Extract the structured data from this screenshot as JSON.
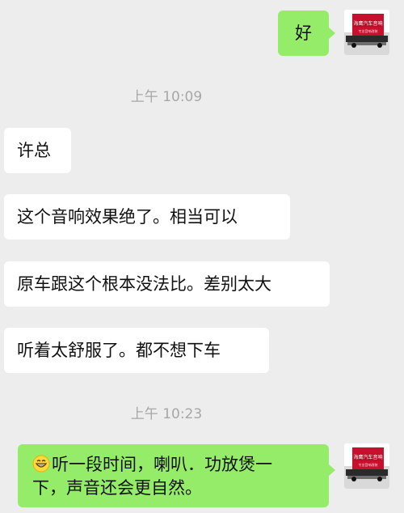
{
  "messages": {
    "top_reply": "好",
    "time_1": "上午 10:09",
    "msg_1": "许总",
    "msg_2": "这个音响效果绝了。相当可以",
    "msg_3": "原车跟这个根本没法比。差别太大",
    "msg_4": "听着太舒服了。都不想下车",
    "time_2": "上午 10:23",
    "reply_line_1": "听一段时间，喇叭．功放煲一",
    "reply_line_2": "下，声音还会更自然。"
  },
  "avatar": {
    "sign_text": "海鹰汽车音响",
    "sign_subtext": "专业音响改装"
  },
  "colors": {
    "background": "#EDEDED",
    "incoming_bubble": "#FFFFFF",
    "outgoing_bubble": "#95EC69",
    "timestamp": "#A7A7A7",
    "text": "#111111"
  },
  "icons": {
    "reply_emoji": "grinning-face-emoji"
  }
}
